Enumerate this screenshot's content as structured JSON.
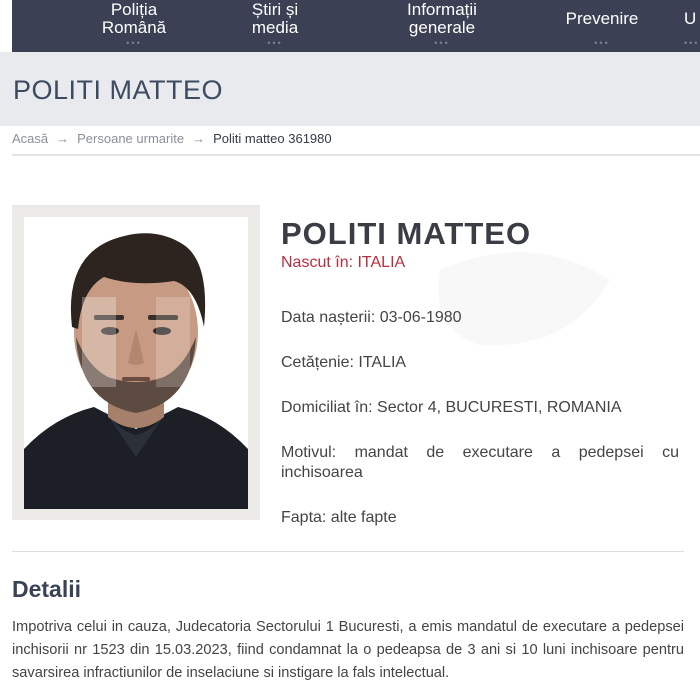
{
  "nav": {
    "items": [
      {
        "label": "Poliția\nRomână"
      },
      {
        "label": "Știri și\nmedia"
      },
      {
        "label": "Informații\ngenerale"
      },
      {
        "label": "Prevenire"
      },
      {
        "label": "U"
      }
    ],
    "dots": "•••"
  },
  "page": {
    "title": "POLITI MATTEO"
  },
  "breadcrumb": {
    "items": [
      "Acasă",
      "Persoane urmarite",
      "Politi matteo 361980"
    ],
    "separator": "→"
  },
  "person": {
    "name": "POLITI MATTEO",
    "born": "Nascut în: ITALIA",
    "birth_date": "Data nașterii: 03-06-1980",
    "citizenship": "Cetățenie: ITALIA",
    "residence": "Domiciliat în: Sector 4, BUCURESTI, ROMANIA",
    "reason": "Motivul: mandat de executare a pedepsei cu inchisoarea",
    "offense": "Fapta: alte fapte"
  },
  "details": {
    "heading": "Detalii",
    "text": "Impotriva celui in cauza, Judecatoria Sectorului 1 Bucuresti, a emis mandatul de executare a pedepsei inchisorii nr 1523 din 15.03.2023, fiind condamnat la o pedeapsa de 3 ani si 10 luni inchisoare pentru savarsirea infractiunilor de inselaciune si instigare la fals intelectual."
  },
  "colors": {
    "nav_bg": "#3b4055",
    "title_band_bg": "#e9eaed",
    "title_text": "#3c4a62",
    "accent_red": "#b5303f",
    "photo_frame": "#eceae6"
  }
}
